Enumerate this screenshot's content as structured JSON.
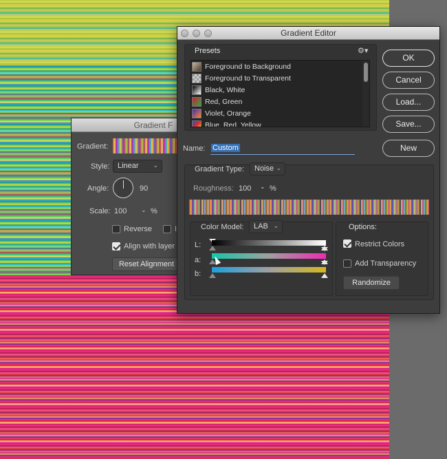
{
  "fill_dialog": {
    "title": "Gradient F",
    "gradient_label": "Gradient:",
    "style_label": "Style:",
    "style_value": "Linear",
    "angle_label": "Angle:",
    "angle_value": "90",
    "scale_label": "Scale:",
    "scale_value": "100",
    "scale_unit": "%",
    "reverse_label": "Reverse",
    "reverse_checked": false,
    "dither_label": "I",
    "align_label": "Align with layer",
    "align_checked": true,
    "reset_button": "Reset Alignment"
  },
  "editor": {
    "title": "Gradient Editor",
    "presets_label": "Presets",
    "presets": [
      {
        "label": "Foreground to Background",
        "colors": [
          "#c9b8a3",
          "#4b3a2b"
        ]
      },
      {
        "label": "Foreground to Transparent",
        "colors": [
          "#c9b8a3",
          "#e0e0e0"
        ]
      },
      {
        "label": "Black, White",
        "colors": [
          "#000000",
          "#ffffff"
        ]
      },
      {
        "label": "Red, Green",
        "colors": [
          "#d21f2a",
          "#2aa84a"
        ]
      },
      {
        "label": "Violet, Orange",
        "colors": [
          "#4b2ab8",
          "#f08a2a"
        ]
      },
      {
        "label": "Blue, Red, Yellow",
        "colors": [
          "#2a4ad0",
          "#e02a2a"
        ]
      }
    ],
    "buttons": {
      "ok": "OK",
      "cancel": "Cancel",
      "load": "Load...",
      "save": "Save...",
      "new": "New"
    },
    "name_label": "Name:",
    "name_value": "Custom",
    "gradient_type_label": "Gradient Type:",
    "gradient_type_value": "Noise",
    "roughness_label": "Roughness:",
    "roughness_value": "100",
    "roughness_unit": "%",
    "color_model_label": "Color Model:",
    "color_model_value": "LAB",
    "channels": [
      {
        "label": "L:"
      },
      {
        "label": "a:"
      },
      {
        "label": "b:"
      }
    ],
    "options_label": "Options:",
    "restrict_colors_label": "Restrict Colors",
    "restrict_colors_checked": true,
    "add_transparency_label": "Add Transparency",
    "add_transparency_checked": false,
    "randomize_button": "Randomize"
  },
  "colors": {
    "dialog_bg": "#3d3d3d",
    "selection_blue": "#3470b4"
  }
}
